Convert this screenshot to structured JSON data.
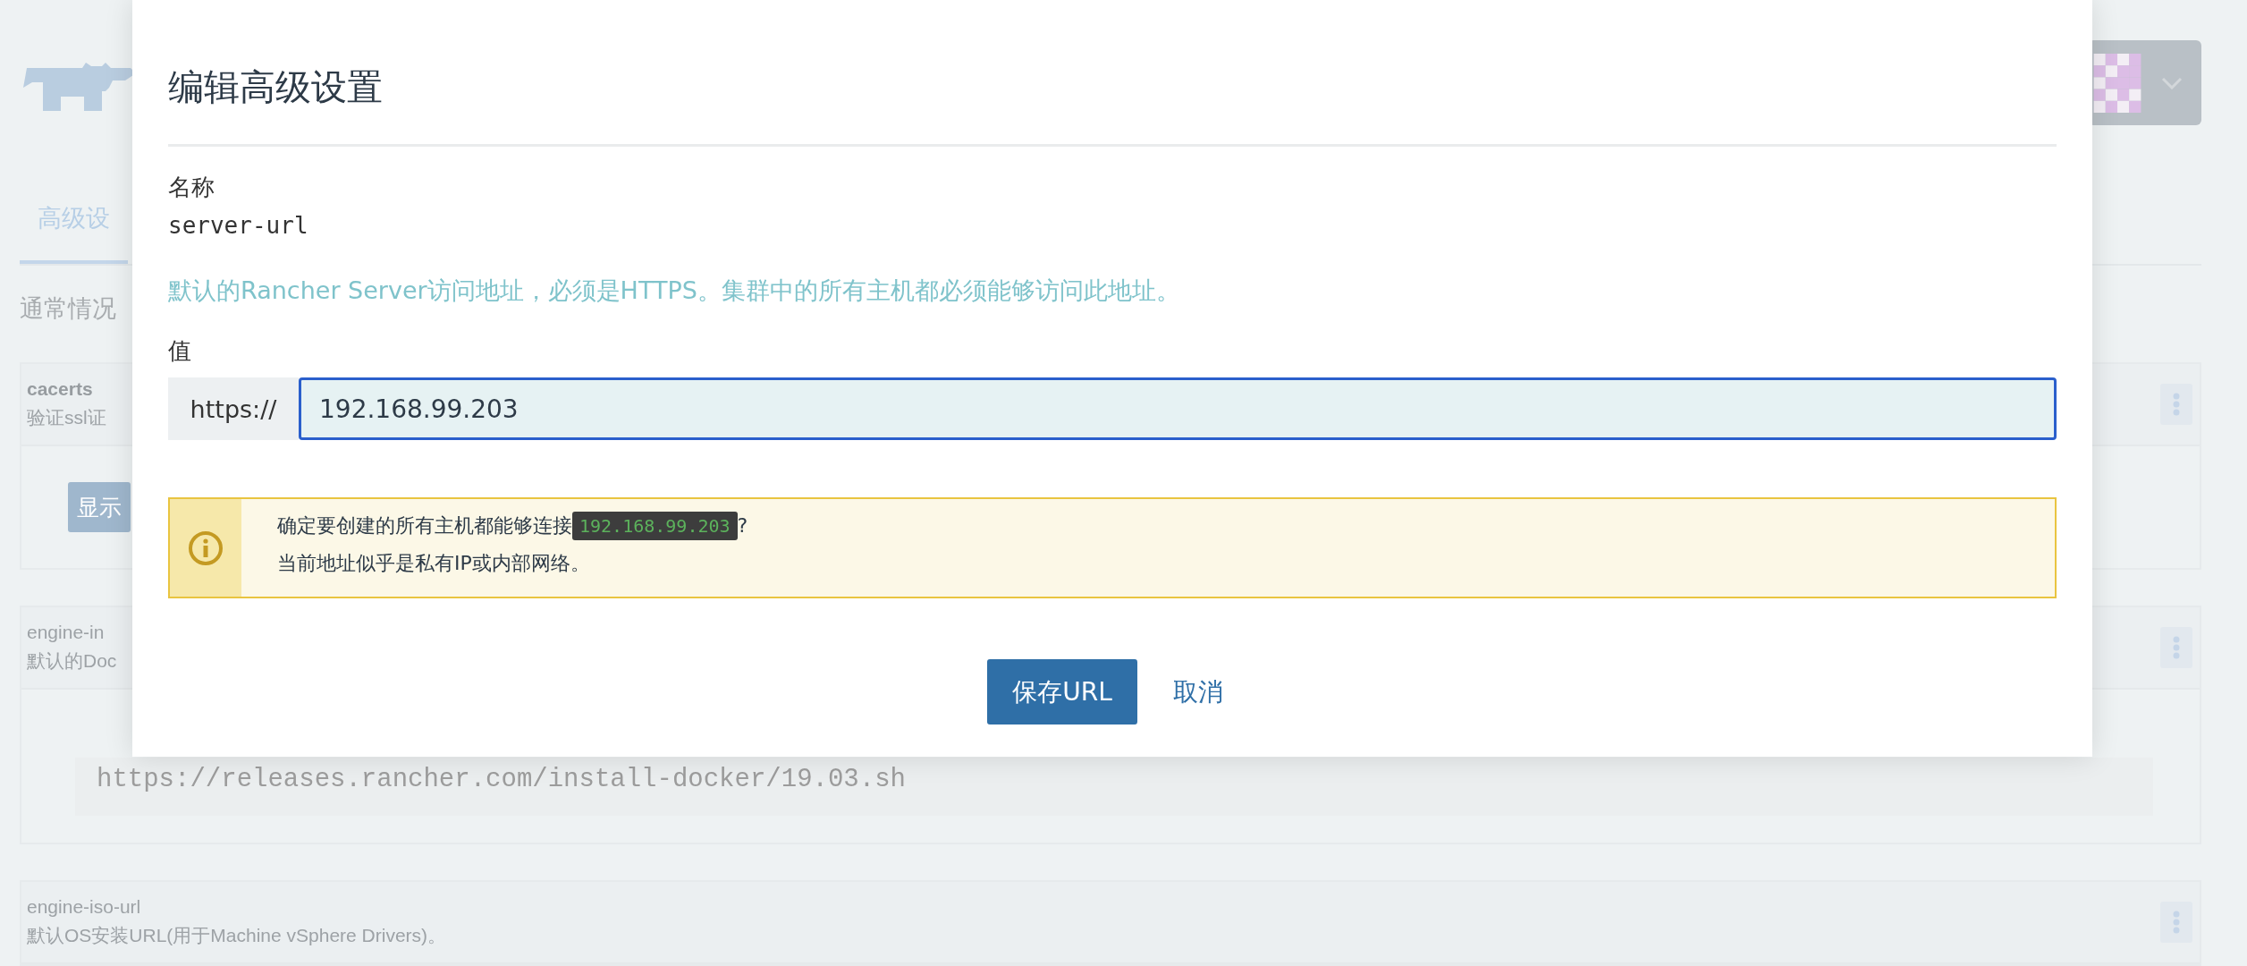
{
  "background": {
    "tabs": [
      {
        "label": "高级设",
        "selected": true
      }
    ],
    "intro": "通常情况",
    "settings": [
      {
        "name": "cacerts",
        "highlighted": true,
        "description": "验证ssl证",
        "button": "显示"
      },
      {
        "name": "engine-in",
        "highlighted": false,
        "description": "默认的Doc",
        "value": "https://releases.rancher.com/install-docker/19.03.sh"
      },
      {
        "name": "engine-iso-url",
        "highlighted": false,
        "description": "默认OS安装URL(用于Machine vSphere Drivers)。"
      }
    ]
  },
  "modal": {
    "title": "编辑高级设置",
    "name_label": "名称",
    "name_value": "server-url",
    "description": "默认的Rancher Server访问地址，必须是HTTPS。集群中的所有主机都必须能够访问此地址。",
    "value_label": "值",
    "input": {
      "prefix": "https://",
      "value": "192.168.99.203",
      "focused": true
    },
    "warning": {
      "message_before": "确定要创建的所有主机都能够连接",
      "code": "192.168.99.203",
      "message_after": "?",
      "note": "当前地址似乎是私有IP或内部网络。"
    },
    "buttons": [
      {
        "label": "保存URL",
        "kind": "primary"
      },
      {
        "label": "取消",
        "kind": "link"
      }
    ]
  }
}
